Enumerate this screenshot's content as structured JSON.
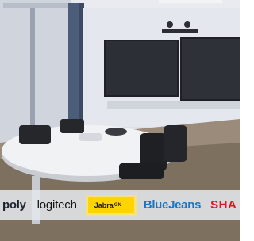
{
  "scene": {
    "description_icon": "conference-room-photo",
    "colors": {
      "wall": "#d7dbe3",
      "floor": "#8b7b6a",
      "table": "#eef0f2",
      "screen": "#26282e",
      "chair": "#222428",
      "column": "#4c5d7a"
    }
  },
  "logos": {
    "poly": "poly",
    "logitech": "logitech",
    "jabra": "Jabra",
    "jabra_sup": "GN",
    "bluejeans": "BlueJeans",
    "sharp": "SHA"
  }
}
